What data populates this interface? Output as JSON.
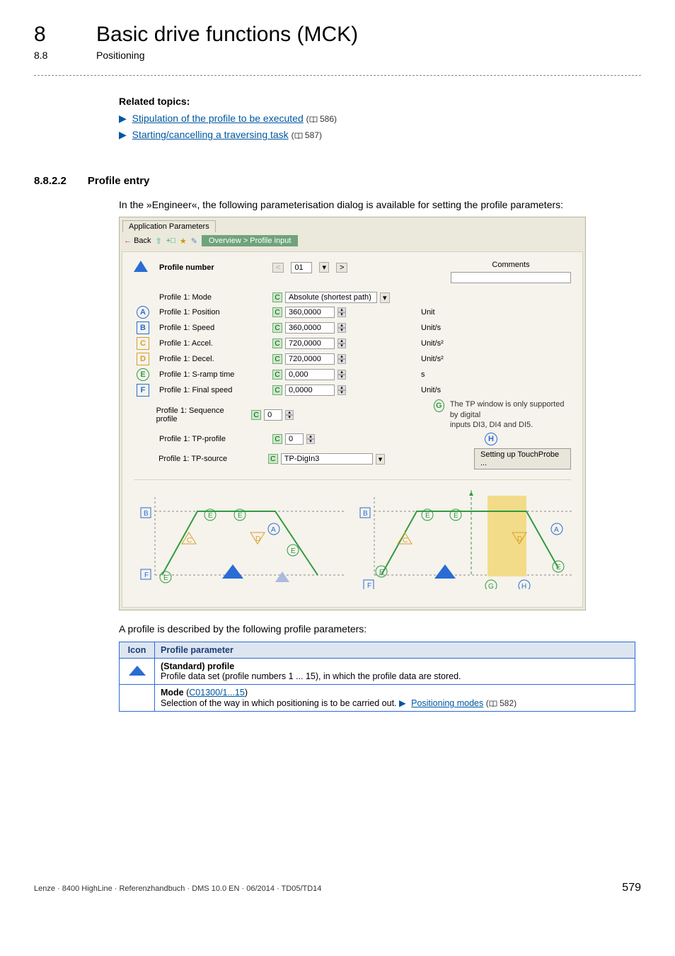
{
  "header": {
    "chapter_num": "8",
    "chapter_title": "Basic drive functions (MCK)",
    "sub_num": "8.8",
    "sub_title": "Positioning"
  },
  "related": {
    "heading": "Related topics:",
    "links": [
      {
        "arrow": "▶",
        "text": "Stipulation of the profile to be executed",
        "page": "586"
      },
      {
        "arrow": "▶",
        "text": "Starting/cancelling a traversing task",
        "page": "587"
      }
    ]
  },
  "section": {
    "num": "8.8.2.2",
    "title": "Profile entry",
    "intro": "In the »Engineer«, the following parameterisation dialog is available for setting the profile parameters:"
  },
  "dialog": {
    "tab": "Application Parameters",
    "back": "Back",
    "crumb": "Overview > Profile input",
    "profile_number_label": "Profile number",
    "profile_number_value": "01",
    "comments_label": "Comments",
    "rows": [
      {
        "icon": "",
        "label": "Profile 1: Mode",
        "value": "Absolute (shortest path)",
        "unit": "",
        "wide": true
      },
      {
        "icon": "A",
        "label": "Profile 1: Position",
        "value": "360,0000",
        "unit": "Unit"
      },
      {
        "icon": "B",
        "label": "Profile 1: Speed",
        "value": "360,0000",
        "unit": "Unit/s"
      },
      {
        "icon": "C",
        "label": "Profile 1: Accel.",
        "value": "720,0000",
        "unit": "Unit/s²"
      },
      {
        "icon": "D",
        "label": "Profile 1: Decel.",
        "value": "720,0000",
        "unit": "Unit/s²"
      },
      {
        "icon": "E",
        "label": "Profile 1: S-ramp time",
        "value": "0,000",
        "unit": "s"
      },
      {
        "icon": "F",
        "label": "Profile 1: Final speed",
        "value": "0,0000",
        "unit": "Unit/s"
      },
      {
        "icon": "",
        "label": "Profile 1: Sequence profile",
        "value": "0",
        "unit": "",
        "spin": true
      },
      {
        "icon": "",
        "label": "Profile 1: TP-profile",
        "value": "0",
        "unit": "",
        "spin": true
      },
      {
        "icon": "",
        "label": "Profile 1: TP-source",
        "value": "TP-DigIn3",
        "unit": "",
        "wide": true
      }
    ],
    "tp_note1": "The TP window is only supported by digital",
    "tp_note2": "inputs DI3, DI4 and DI5.",
    "touchprobe_btn": "Setting up TouchProbe ...",
    "tp_g": "G",
    "tp_h": "H"
  },
  "post_text": "A profile is described by the following profile parameters:",
  "table": {
    "head_icon": "Icon",
    "head_param": "Profile parameter",
    "r1_title": "(Standard) profile",
    "r1_body": "Profile data set (profile numbers 1 ... 15), in which the profile data are stored.",
    "r2_mode_word": "Mode",
    "r2_code": "C01300/1...15",
    "r2_body_prefix": "Selection of the way in which positioning is to be carried out.  ",
    "r2_link": "Positioning modes",
    "r2_page": "582"
  },
  "footer": {
    "left": "Lenze · 8400 HighLine · Referenzhandbuch · DMS 10.0 EN · 06/2014 · TD05/TD14",
    "page": "579"
  }
}
